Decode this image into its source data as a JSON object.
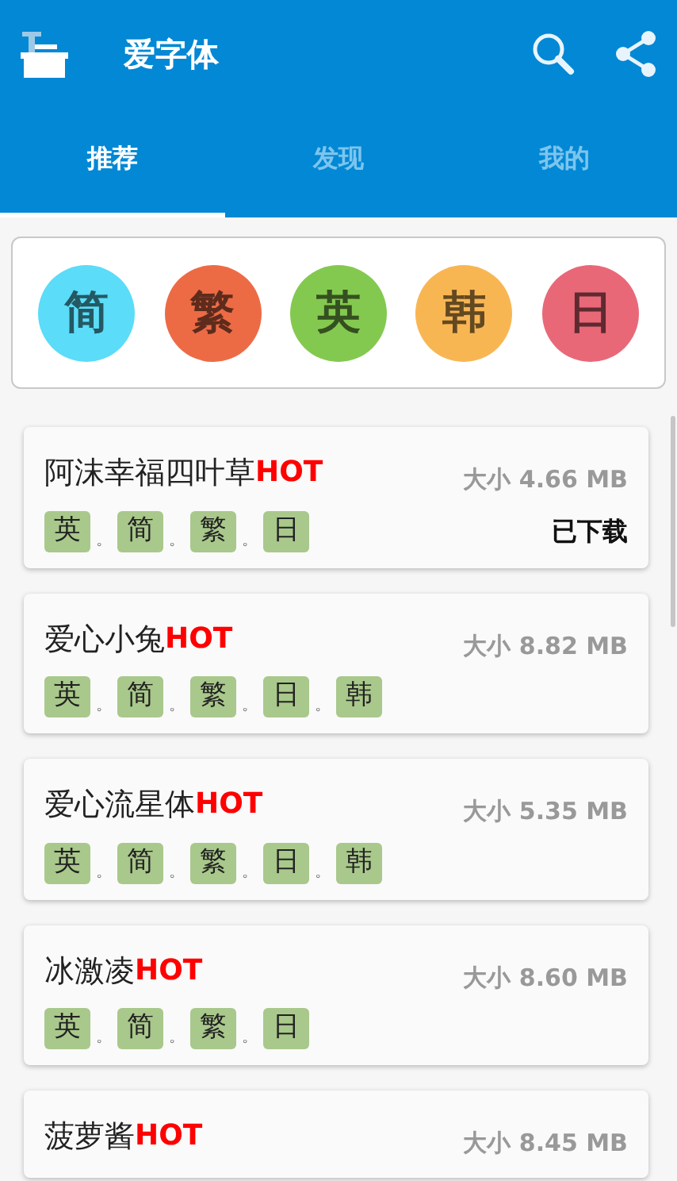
{
  "app_bar": {
    "title": "爱字体"
  },
  "tabs": [
    {
      "label": "推荐",
      "selected": true
    },
    {
      "label": "发现",
      "selected": false
    },
    {
      "label": "我的",
      "selected": false
    }
  ],
  "categories": [
    {
      "label": "简",
      "color": "#5bdcf8"
    },
    {
      "label": "繁",
      "color": "#ec6b45"
    },
    {
      "label": "英",
      "color": "#84c94f"
    },
    {
      "label": "韩",
      "color": "#f8b653"
    },
    {
      "label": "日",
      "color": "#e96878"
    }
  ],
  "fonts": [
    {
      "name": "阿沫幸福四叶草",
      "badge": "HOT",
      "size": "大小 4.66 MB",
      "status": "已下载",
      "tags": [
        {
          "kind": "tag",
          "text": "英"
        },
        {
          "kind": "separator",
          "text": "。"
        },
        {
          "kind": "tag",
          "text": "简"
        },
        {
          "kind": "separator",
          "text": "。"
        },
        {
          "kind": "tag",
          "text": "繁"
        },
        {
          "kind": "separator",
          "text": "。"
        },
        {
          "kind": "tag",
          "text": "日"
        }
      ]
    },
    {
      "name": "爱心小兔",
      "badge": "HOT",
      "size": "大小 8.82 MB",
      "tags": [
        {
          "kind": "tag",
          "text": "英"
        },
        {
          "kind": "separator",
          "text": "。"
        },
        {
          "kind": "tag",
          "text": "简"
        },
        {
          "kind": "separator",
          "text": "。"
        },
        {
          "kind": "tag",
          "text": "繁"
        },
        {
          "kind": "separator",
          "text": "。"
        },
        {
          "kind": "tag",
          "text": "日"
        },
        {
          "kind": "separator",
          "text": "。"
        },
        {
          "kind": "tag",
          "text": "韩"
        }
      ]
    },
    {
      "name": "爱心流星体",
      "badge": "HOT",
      "size": "大小 5.35 MB",
      "tags": [
        {
          "kind": "tag",
          "text": "英"
        },
        {
          "kind": "separator",
          "text": "。"
        },
        {
          "kind": "tag",
          "text": "简"
        },
        {
          "kind": "separator",
          "text": "。"
        },
        {
          "kind": "tag",
          "text": "繁"
        },
        {
          "kind": "separator",
          "text": "。"
        },
        {
          "kind": "tag",
          "text": "日"
        },
        {
          "kind": "separator",
          "text": "。"
        },
        {
          "kind": "tag",
          "text": "韩"
        }
      ]
    },
    {
      "name": "冰激凌",
      "badge": "HOT",
      "size": "大小 8.60 MB",
      "tags": [
        {
          "kind": "tag",
          "text": "英"
        },
        {
          "kind": "separator",
          "text": "。"
        },
        {
          "kind": "tag",
          "text": "简"
        },
        {
          "kind": "separator",
          "text": "。"
        },
        {
          "kind": "tag",
          "text": "繁"
        },
        {
          "kind": "separator",
          "text": "。"
        },
        {
          "kind": "tag",
          "text": "日"
        }
      ]
    },
    {
      "name": "菠萝酱",
      "badge": "HOT",
      "size": "大小 8.45 MB"
    }
  ]
}
